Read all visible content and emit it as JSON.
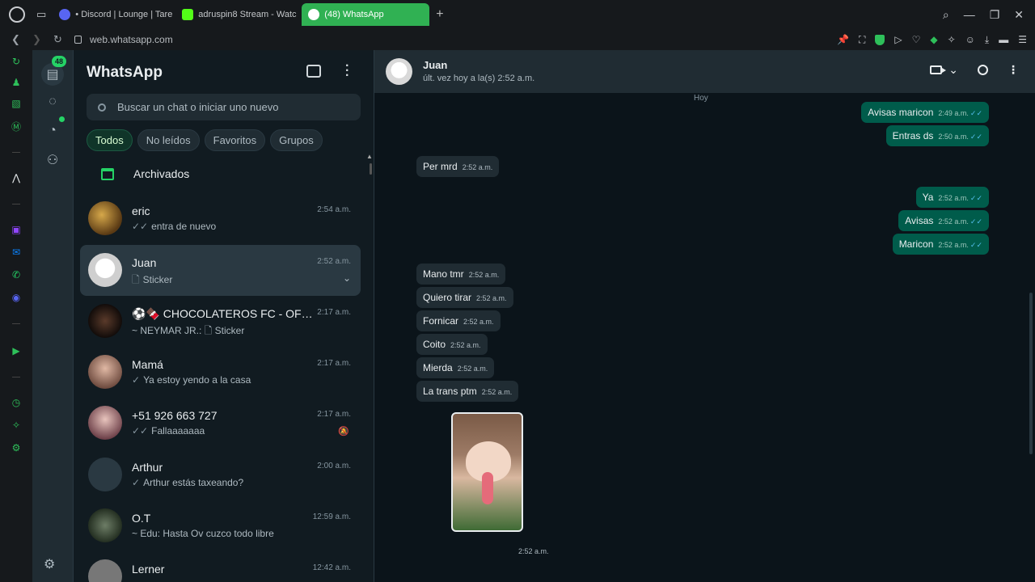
{
  "browser": {
    "tabs": [
      {
        "label": "• Discord | Lounge | Tare",
        "favicon_color": "#5865f2"
      },
      {
        "label": "adruspin8 Stream - Watc",
        "favicon_color": "#53fc18"
      },
      {
        "label": "(48) WhatsApp",
        "favicon_color": "#25d366"
      }
    ],
    "url": "web.whatsapp.com"
  },
  "rail": {
    "chats_badge": "48"
  },
  "list": {
    "title": "WhatsApp",
    "search_placeholder": "Buscar un chat o iniciar uno nuevo",
    "filters": [
      "Todos",
      "No leídos",
      "Favoritos",
      "Grupos"
    ],
    "active_filter": "Todos",
    "archived_label": "Archivados",
    "chats": [
      {
        "name": "eric",
        "time": "2:54 a.m.",
        "tick": "✓✓",
        "preview": "entra de nuevo",
        "avatar_color": "#8a6a2e"
      },
      {
        "name": "Juan",
        "time": "2:52 a.m.",
        "tick": "🗋",
        "preview": "Sticker",
        "avatar_color": "#dcdcdc"
      },
      {
        "name": "⚽🍫 CHOCOLATEROS FC - OFICIAL...",
        "time": "2:17 a.m.",
        "tick": "",
        "preview": "~ NEYMAR JR.: 🗋 Sticker",
        "avatar_color": "#2b1d17"
      },
      {
        "name": "Mamá",
        "time": "2:17 a.m.",
        "tick": "✓",
        "preview": "Ya estoy yendo a la casa",
        "avatar_color": "#b28778"
      },
      {
        "name": "+51 926 663 727",
        "time": "2:17 a.m.",
        "tick": "✓✓",
        "preview": "Fallaaaaaaa",
        "avatar_color": "#a9797d"
      },
      {
        "name": "Arthur",
        "time": "2:00 a.m.",
        "tick": "✓",
        "preview": "Arthur estás taxeando?",
        "avatar_color": "#6b7b85"
      },
      {
        "name": "O.T",
        "time": "12:59 a.m.",
        "tick": "",
        "preview": "~ Edu: Hasta Ov cuzco todo libre",
        "avatar_color": "#3c4a3a"
      },
      {
        "name": "Lerner",
        "time": "12:42 a.m.",
        "tick": "",
        "preview": "",
        "avatar_color": "#777777"
      }
    ]
  },
  "conversation": {
    "name": "Juan",
    "status": "últ. vez hoy a la(s) 2:52 a.m.",
    "date_chip": "Hoy",
    "messages": [
      {
        "dir": "out",
        "text": "Avisas maricon",
        "time": "2:49 a.m."
      },
      {
        "dir": "out",
        "text": "Entras ds",
        "time": "2:50 a.m."
      },
      {
        "dir": "in",
        "text": "Per mrd",
        "time": "2:52 a.m."
      },
      {
        "dir": "out",
        "text": "Ya",
        "time": "2:52 a.m."
      },
      {
        "dir": "out",
        "text": "Avisas",
        "time": "2:52 a.m."
      },
      {
        "dir": "out",
        "text": "Maricon",
        "time": "2:52 a.m."
      },
      {
        "dir": "in",
        "text": "Mano tmr",
        "time": "2:52 a.m."
      },
      {
        "dir": "in",
        "text": "Quiero tirar",
        "time": "2:52 a.m."
      },
      {
        "dir": "in",
        "text": "Fornicar",
        "time": "2:52 a.m."
      },
      {
        "dir": "in",
        "text": "Coito",
        "time": "2:52 a.m."
      },
      {
        "dir": "in",
        "text": "Mierda",
        "time": "2:52 a.m."
      },
      {
        "dir": "in",
        "text": "La trans ptm",
        "time": "2:52 a.m."
      }
    ],
    "sticker_time": "2:52 a.m."
  }
}
